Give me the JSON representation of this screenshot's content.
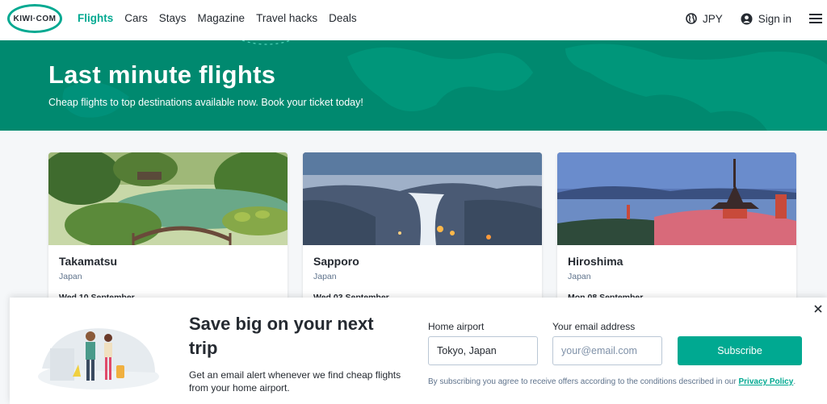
{
  "header": {
    "logo_text": "KIWI·COM",
    "nav": [
      {
        "label": "Flights",
        "active": true
      },
      {
        "label": "Cars",
        "active": false
      },
      {
        "label": "Stays",
        "active": false
      },
      {
        "label": "Magazine",
        "active": false
      },
      {
        "label": "Travel hacks",
        "active": false
      },
      {
        "label": "Deals",
        "active": false
      }
    ],
    "currency": "JPY",
    "sign_in": "Sign in"
  },
  "hero": {
    "title": "Last minute flights",
    "subtitle": "Cheap flights to top destinations available now. Book your ticket today!"
  },
  "cards": [
    {
      "city": "Takamatsu",
      "country": "Japan",
      "date": "Wed 10 September"
    },
    {
      "city": "Sapporo",
      "country": "Japan",
      "date": "Wed 03 September"
    },
    {
      "city": "Hiroshima",
      "country": "Japan",
      "date": "Mon 08 September"
    }
  ],
  "subscribe": {
    "title": "Save big on your next trip",
    "text": "Get an email alert whenever we find cheap flights from your home airport.",
    "home_airport_label": "Home airport",
    "home_airport_value": "Tokyo, Japan",
    "email_label": "Your email address",
    "email_placeholder": "your@email.com",
    "button": "Subscribe",
    "legal_text": "By subscribing you agree to receive offers according to the conditions described in our",
    "privacy_link": "Privacy Policy",
    "legal_end": "."
  },
  "colors": {
    "brand": "#00a991",
    "hero_bg": "#00896f"
  },
  "icons": [
    "globe-icon",
    "user-icon",
    "menu-icon",
    "close-icon"
  ]
}
